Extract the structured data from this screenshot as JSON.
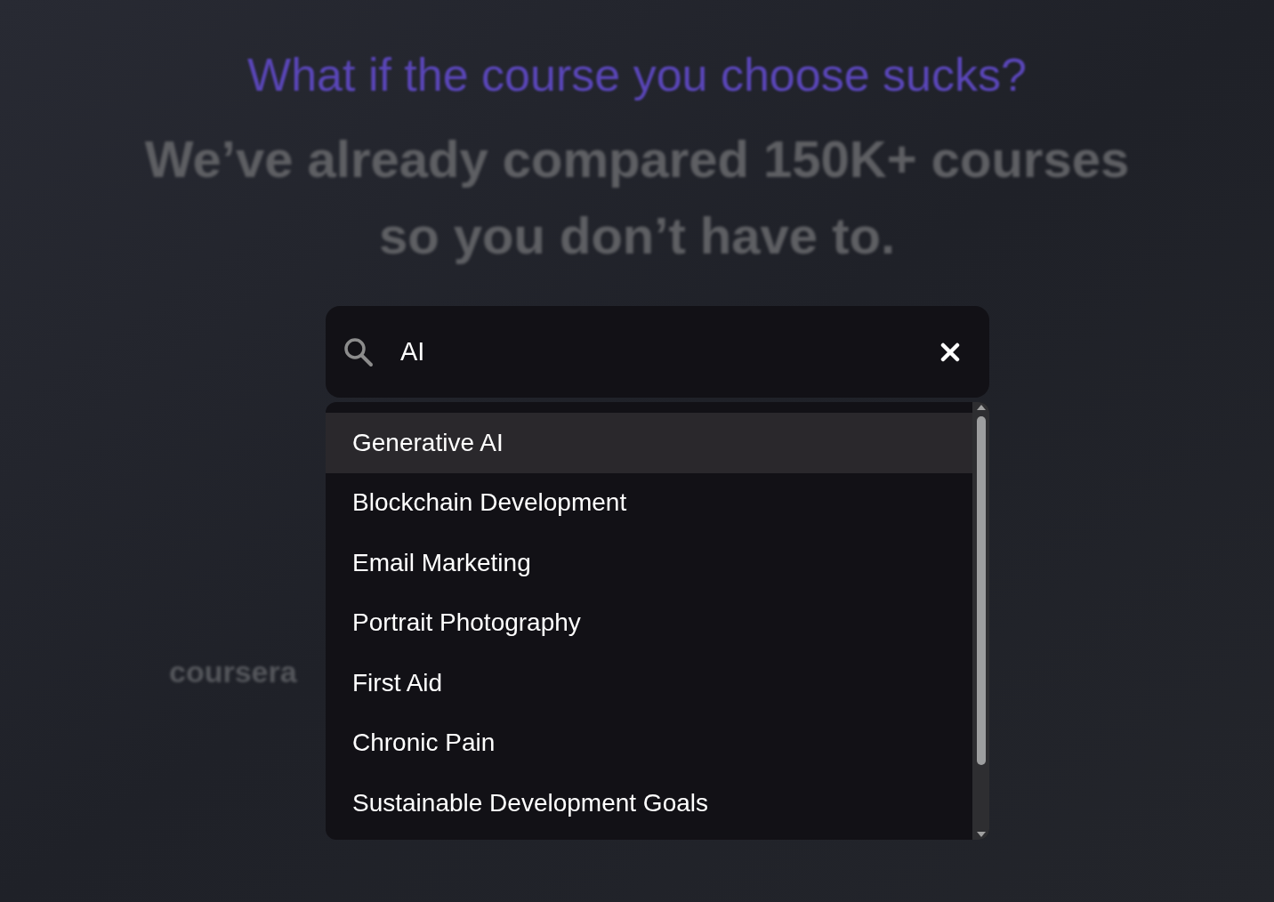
{
  "hero": {
    "question": "What if the course you choose sucks?",
    "headline": "We’ve already compared 150K+ courses so you don’t have to."
  },
  "search": {
    "value": "AI"
  },
  "suggestions": [
    {
      "label": "Generative AI",
      "selected": true
    },
    {
      "label": "Blockchain Development",
      "selected": false
    },
    {
      "label": "Email Marketing",
      "selected": false
    },
    {
      "label": "Portrait Photography",
      "selected": false
    },
    {
      "label": "First Aid",
      "selected": false
    },
    {
      "label": "Chronic Pain",
      "selected": false
    },
    {
      "label": "Sustainable Development Goals",
      "selected": false
    }
  ],
  "partners": [
    "coursera"
  ]
}
